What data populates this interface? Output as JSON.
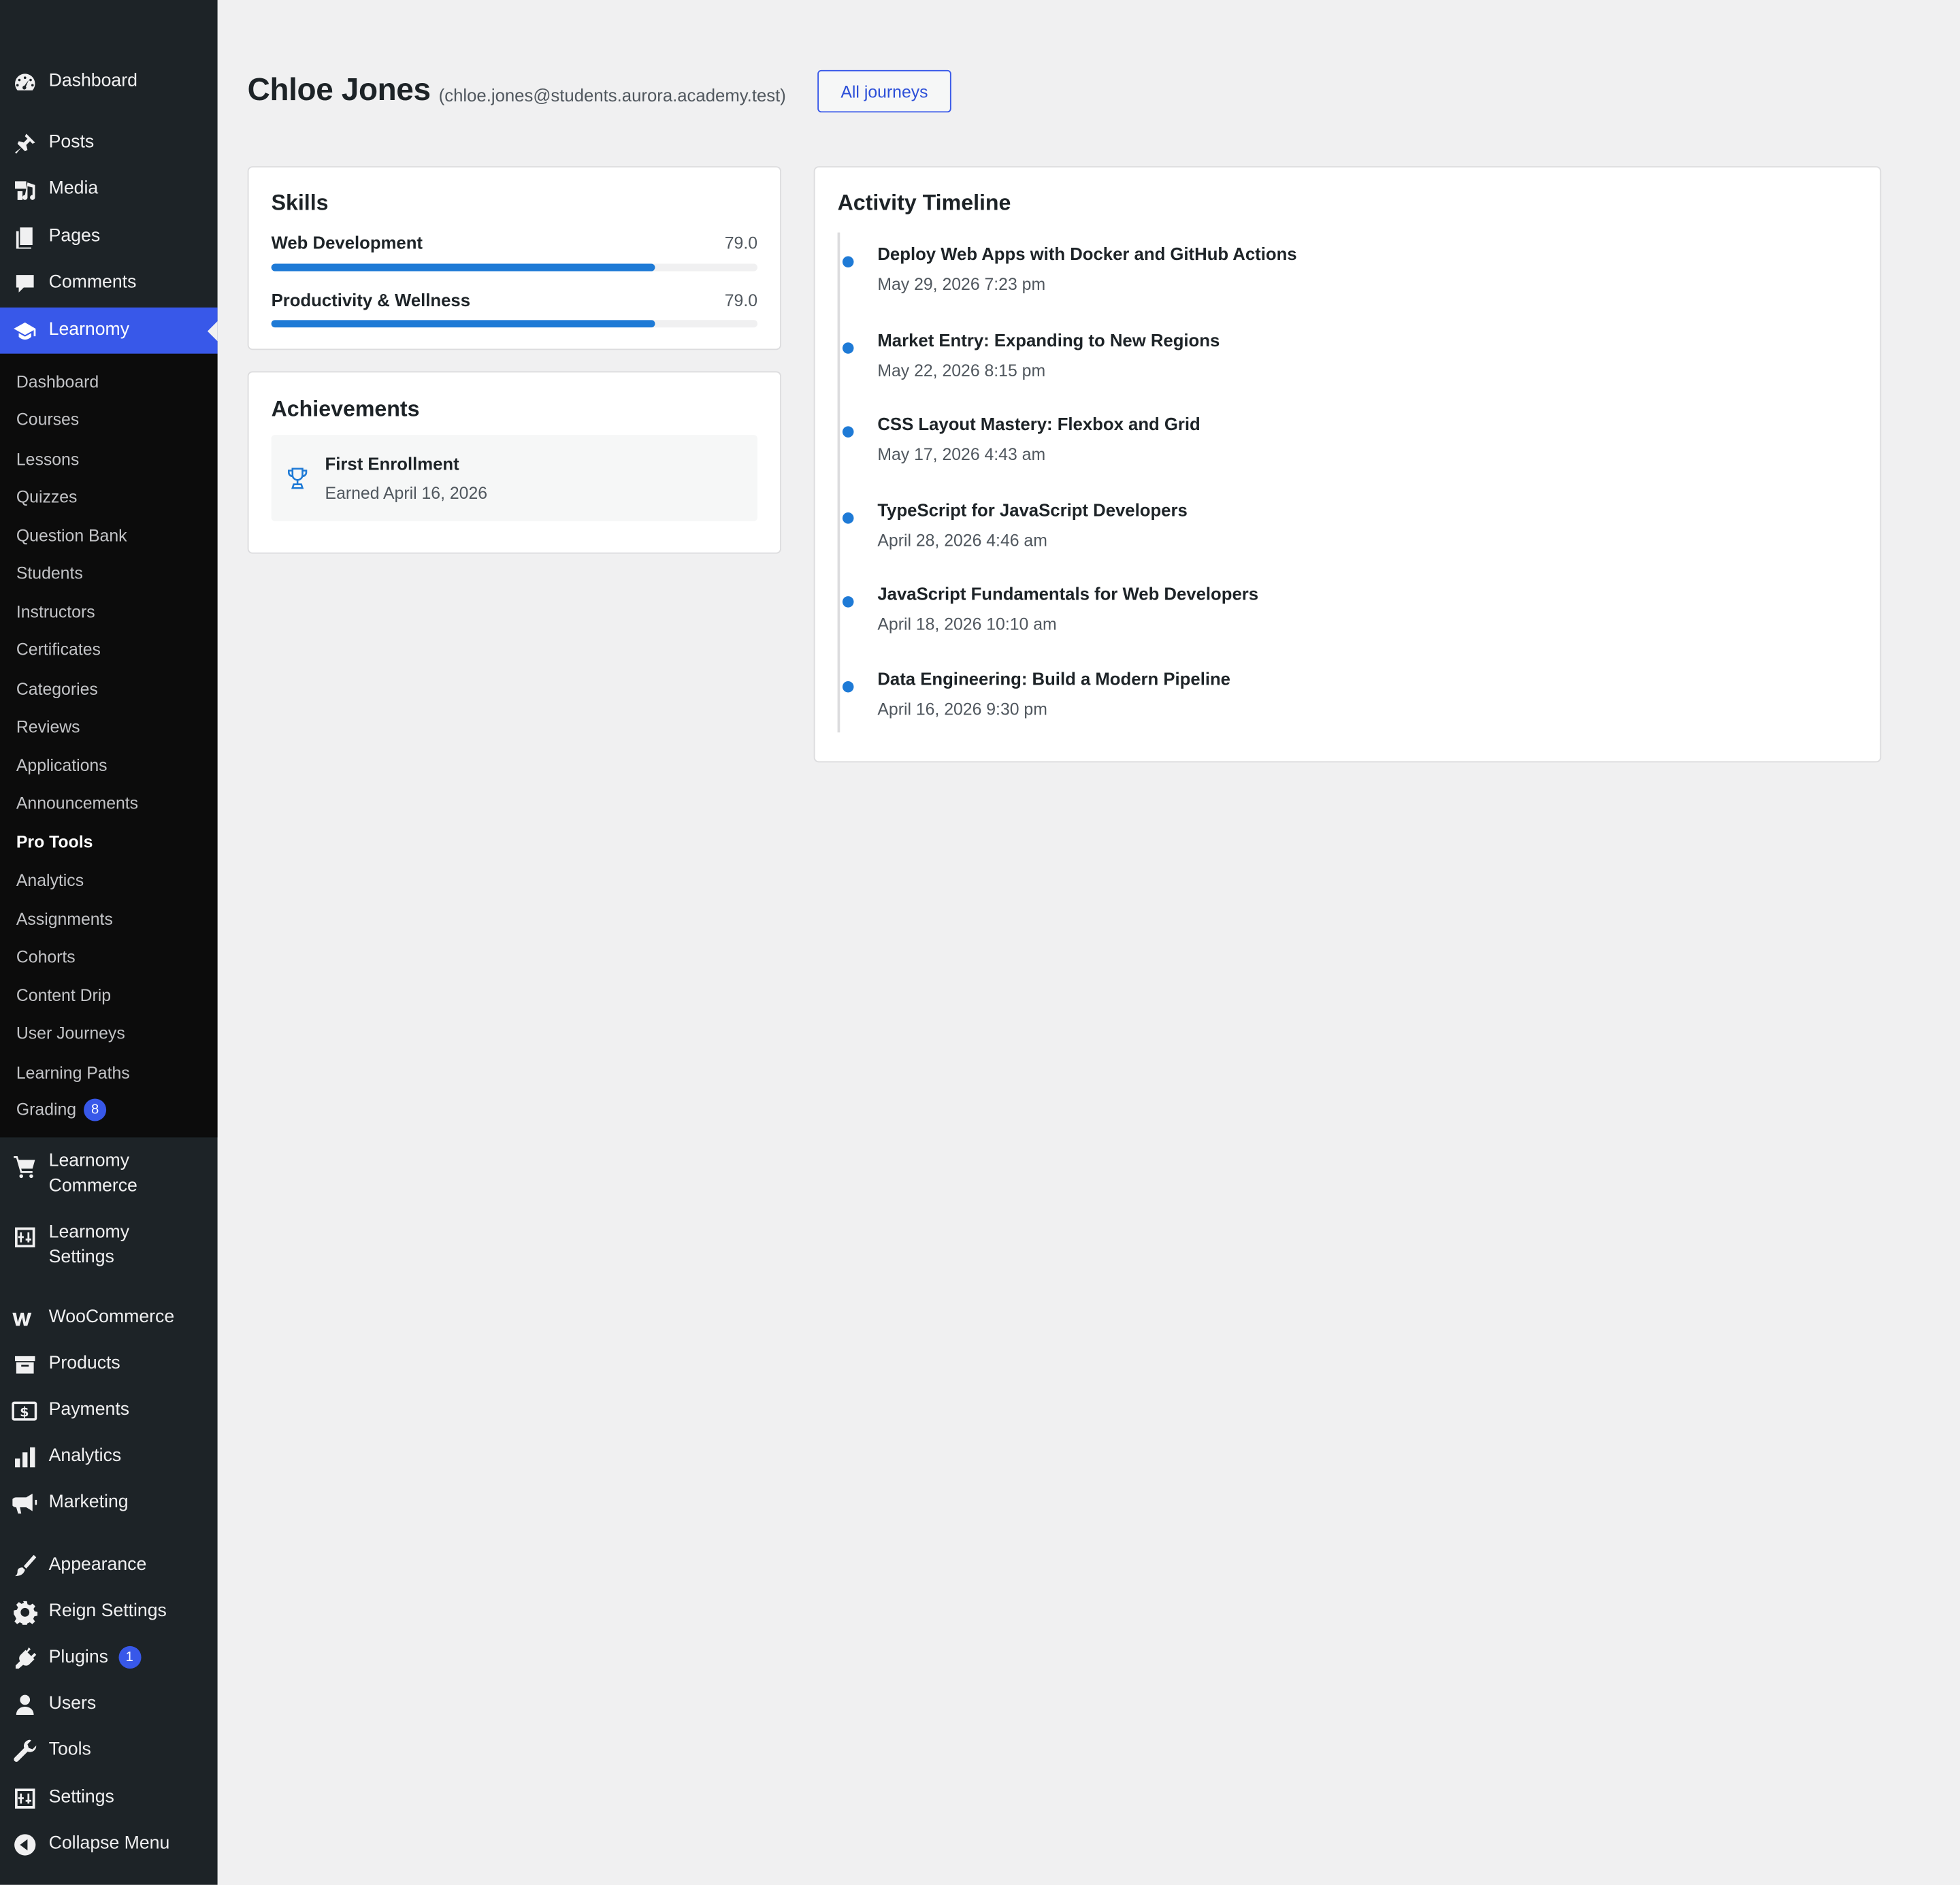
{
  "sidebar": {
    "menu": [
      {
        "label": "Dashboard",
        "icon": "dashboard-icon"
      },
      {
        "label": "Posts",
        "icon": "pin-icon"
      },
      {
        "label": "Media",
        "icon": "media-icon"
      },
      {
        "label": "Pages",
        "icon": "pages-icon"
      },
      {
        "label": "Comments",
        "icon": "comment-icon"
      },
      {
        "label": "Learnomy",
        "icon": "graduation-cap-icon",
        "active": true
      }
    ],
    "submenu": [
      "Dashboard",
      "Courses",
      "Lessons",
      "Quizzes",
      "Question Bank",
      "Students",
      "Instructors",
      "Certificates",
      "Categories",
      "Reviews",
      "Applications",
      "Announcements",
      "Pro Tools",
      "Analytics",
      "Assignments",
      "Cohorts",
      "Content Drip",
      "User Journeys",
      "Learning Paths",
      "Grading"
    ],
    "grading_badge": "8",
    "menu_lower": [
      {
        "label": "Learnomy Commerce",
        "icon": "cart-icon"
      },
      {
        "label": "Learnomy Settings",
        "icon": "settings-sliders-icon"
      },
      {
        "label": "WooCommerce",
        "icon": "woocommerce-icon"
      },
      {
        "label": "Products",
        "icon": "archive-icon"
      },
      {
        "label": "Payments",
        "icon": "dollar-icon"
      },
      {
        "label": "Analytics",
        "icon": "bar-chart-icon"
      },
      {
        "label": "Marketing",
        "icon": "megaphone-icon"
      },
      {
        "label": "Appearance",
        "icon": "brush-icon"
      },
      {
        "label": "Reign Settings",
        "icon": "gear-icon"
      },
      {
        "label": "Plugins",
        "icon": "plugin-icon"
      },
      {
        "label": "Users",
        "icon": "user-icon"
      },
      {
        "label": "Tools",
        "icon": "wrench-icon"
      },
      {
        "label": "Settings",
        "icon": "settings-sliders-icon"
      },
      {
        "label": "Collapse Menu",
        "icon": "collapse-icon"
      }
    ],
    "plugins_badge": "1"
  },
  "header": {
    "name": "Chloe Jones",
    "email": "(chloe.jones@students.aurora.academy.test)",
    "all_journeys_label": "All journeys"
  },
  "skills": {
    "title": "Skills",
    "items": [
      {
        "name": "Web Development",
        "value": "79.0",
        "fraction": 0.79
      },
      {
        "name": "Productivity & Wellness",
        "value": "79.0",
        "fraction": 0.79
      }
    ]
  },
  "achievements": {
    "title": "Achievements",
    "items": [
      {
        "title": "First Enrollment",
        "date": "Earned April 16, 2026",
        "icon": "trophy-icon"
      }
    ]
  },
  "timeline": {
    "title": "Activity Timeline",
    "items": [
      {
        "title": "Deploy Web Apps with Docker and GitHub Actions",
        "date": "May 29, 2026 7:23 pm"
      },
      {
        "title": "Market Entry: Expanding to New Regions",
        "date": "May 22, 2026 8:15 pm"
      },
      {
        "title": "CSS Layout Mastery: Flexbox and Grid",
        "date": "May 17, 2026 4:43 am"
      },
      {
        "title": "TypeScript for JavaScript Developers",
        "date": "April 28, 2026 4:46 am"
      },
      {
        "title": "JavaScript Fundamentals for Web Developers",
        "date": "April 18, 2026 10:10 am"
      },
      {
        "title": "Data Engineering: Build a Modern Pipeline",
        "date": "April 16, 2026 9:30 pm"
      }
    ]
  },
  "colors": {
    "sidebar_bg": "#1d2327",
    "accent": "#3858e9",
    "bar": "#1e7ad6"
  }
}
